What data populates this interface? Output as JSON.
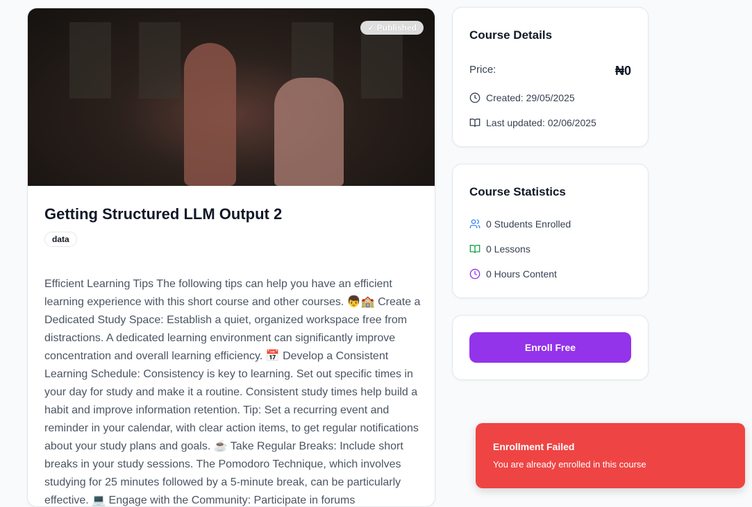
{
  "course": {
    "title": "Getting Structured LLM Output 2",
    "status_badge": "✓ Published",
    "tag": "data",
    "description": "Efficient Learning Tips The following tips can help you have an efficient learning experience with this short course and other courses. 👦🏫 Create a Dedicated Study Space: Establish a quiet, organized workspace free from distractions. A dedicated learning environment can significantly improve concentration and overall learning efficiency. 📅 Develop a Consistent Learning Schedule: Consistency is key to learning. Set out specific times in your day for study and make it a routine. Consistent study times help build a habit and improve information retention. Tip: Set a recurring event and reminder in your calendar, with clear action items, to get regular notifications about your study plans and goals. ☕ Take Regular Breaks: Include short breaks in your study sessions. The Pomodoro Technique, which involves studying for 25 minutes followed by a 5-minute break, can be particularly effective. 💻 Engage with the Community: Participate in forums"
  },
  "details": {
    "heading": "Course Details",
    "price_label": "Price:",
    "price": "₦0",
    "created": "Created: 29/05/2025",
    "updated": "Last updated: 02/06/2025"
  },
  "stats": {
    "heading": "Course Statistics",
    "students": "0 Students Enrolled",
    "lessons": "0 Lessons",
    "hours": "0 Hours Content"
  },
  "enroll": {
    "label": "Enroll Free"
  },
  "toast": {
    "title": "Enrollment Failed",
    "message": "You are already enrolled in this course"
  },
  "colors": {
    "accent": "#9333ea",
    "error": "#ef4444",
    "students": "#3b82f6",
    "lessons": "#16a34a",
    "hours": "#9333ea"
  }
}
